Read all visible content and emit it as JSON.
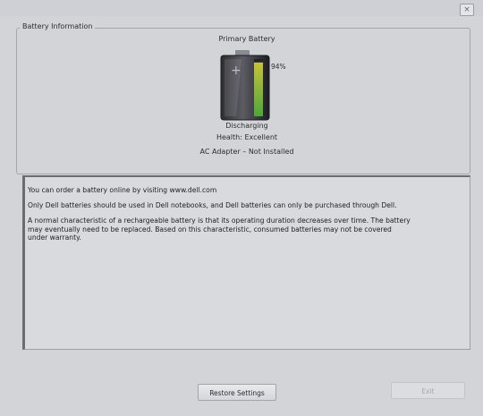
{
  "window": {
    "corner_button_glyph": "×"
  },
  "battery_info": {
    "group_title": "Battery Information",
    "battery_label": "Primary Battery",
    "charge_fraction": 0.94,
    "charge_label": "94%",
    "status": "Discharging",
    "health": "Health: Excellent",
    "ac_adapter": "AC Adapter – Not Installed"
  },
  "messages": {
    "order_online": "You can order a battery online by visiting www.dell.com",
    "dell_only": "Only Dell batteries should be used in Dell notebooks, and Dell batteries can only be purchased through Dell.",
    "characteristic_line1": "A normal characteristic of a rechargeable battery is that its operating duration decreases over time.  The battery",
    "characteristic_line2": "may eventually need to be replaced.  Based on this characteristic, consumed batteries may not be covered",
    "characteristic_line3": "under warranty."
  },
  "buttons": {
    "restore": "Restore Settings",
    "exit": "Exit"
  },
  "colors": {
    "charge_green": "#4ea63a",
    "charge_yellow": "#c8c23a"
  },
  "icons": {
    "battery": "battery-icon",
    "corner": "close-icon"
  }
}
